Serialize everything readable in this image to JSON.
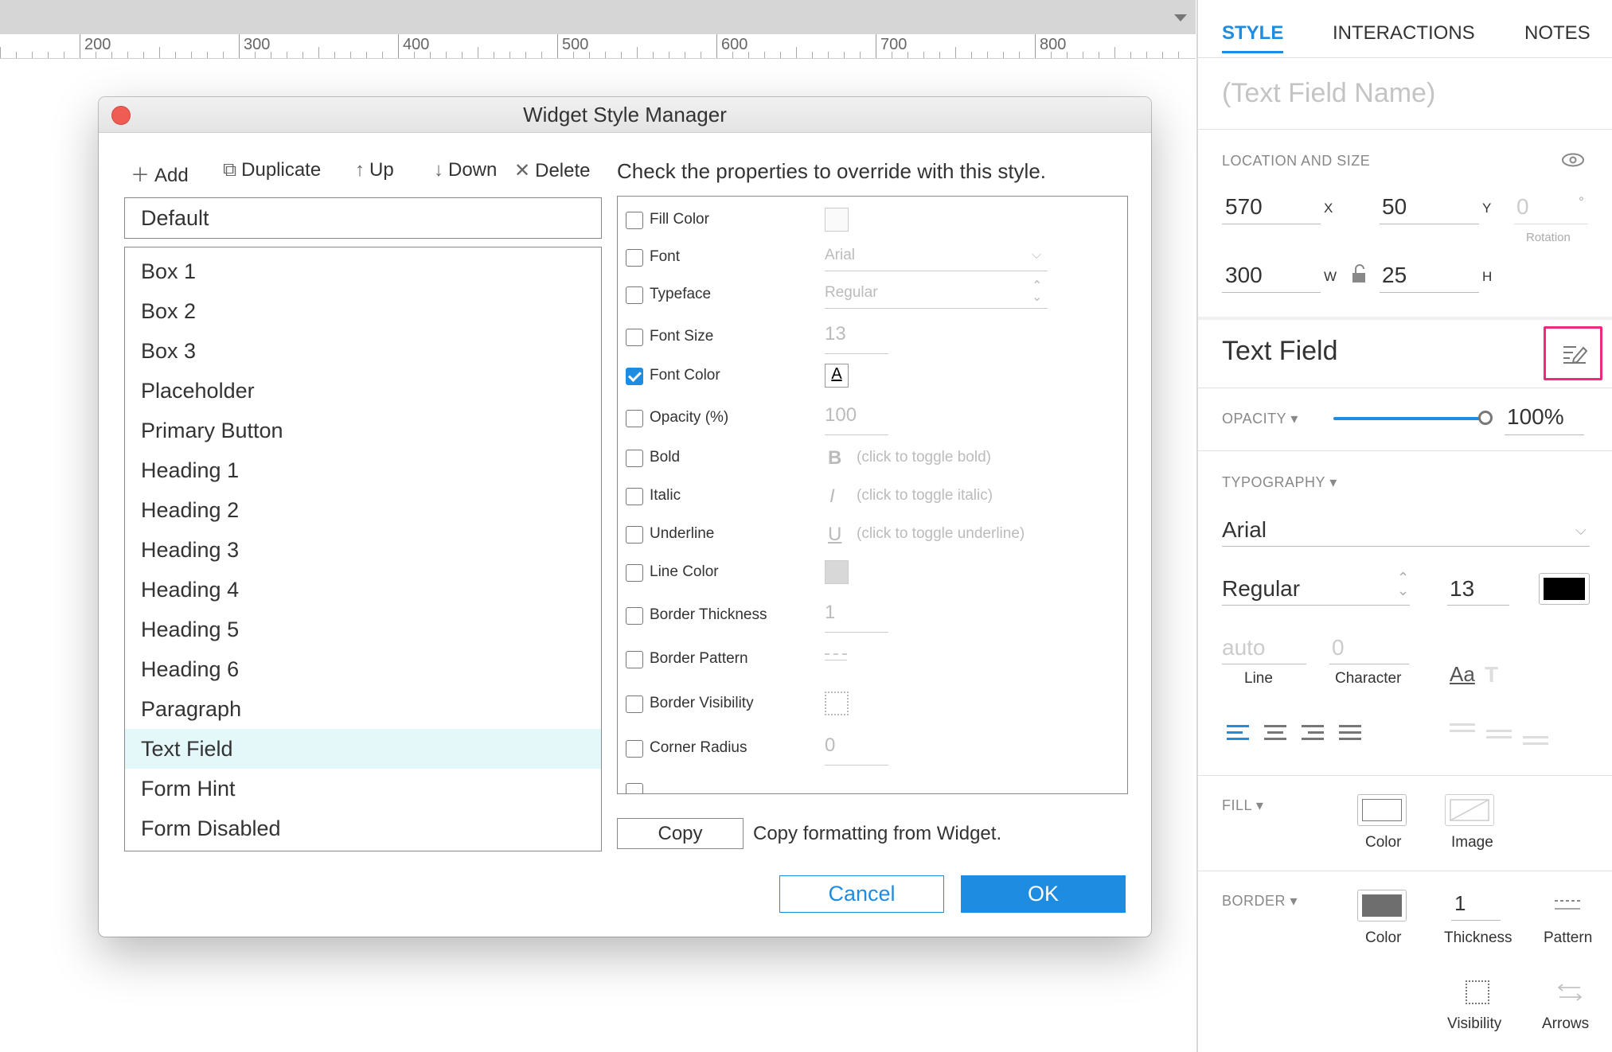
{
  "ruler": {
    "labels": [
      "200",
      "300",
      "400",
      "500",
      "600",
      "700",
      "800"
    ]
  },
  "dialog": {
    "title": "Widget Style Manager",
    "toolbar": {
      "add": "Add",
      "duplicate": "Duplicate",
      "up": "Up",
      "down": "Down",
      "delete": "Delete"
    },
    "default_style": "Default",
    "styles": [
      "Box 1",
      "Box 2",
      "Box 3",
      "Placeholder",
      "Primary Button",
      "Heading 1",
      "Heading 2",
      "Heading 3",
      "Heading 4",
      "Heading 5",
      "Heading 6",
      "Paragraph",
      "Text Field",
      "Form Hint",
      "Form Disabled"
    ],
    "selected_style": "Text Field",
    "override_heading": "Check the properties to override with this style.",
    "properties": {
      "fill_color": {
        "label": "Fill Color",
        "checked": false
      },
      "font": {
        "label": "Font",
        "value": "Arial",
        "checked": false
      },
      "typeface": {
        "label": "Typeface",
        "value": "Regular",
        "checked": false
      },
      "font_size": {
        "label": "Font Size",
        "value": "13",
        "checked": false
      },
      "font_color": {
        "label": "Font Color",
        "checked": true
      },
      "opacity": {
        "label": "Opacity (%)",
        "value": "100",
        "checked": false
      },
      "bold": {
        "label": "Bold",
        "hint": "(click to toggle bold)",
        "checked": false
      },
      "italic": {
        "label": "Italic",
        "hint": "(click to toggle italic)",
        "checked": false
      },
      "underline": {
        "label": "Underline",
        "hint": "(click to toggle underline)",
        "checked": false
      },
      "line_color": {
        "label": "Line Color",
        "checked": false
      },
      "border_thickness": {
        "label": "Border Thickness",
        "value": "1",
        "checked": false
      },
      "border_pattern": {
        "label": "Border Pattern",
        "checked": false
      },
      "border_visibility": {
        "label": "Border Visibility",
        "checked": false
      },
      "corner_radius": {
        "label": "Corner Radius",
        "value": "0",
        "checked": false
      }
    },
    "copy_button": "Copy",
    "copy_text": "Copy formatting from Widget.",
    "cancel": "Cancel",
    "ok": "OK"
  },
  "right_panel": {
    "tabs": {
      "style": "STYLE",
      "interactions": "INTERACTIONS",
      "notes": "NOTES"
    },
    "name_placeholder": "(Text Field Name)",
    "location": {
      "heading": "LOCATION AND SIZE",
      "x": "570",
      "x_label": "X",
      "y": "50",
      "y_label": "Y",
      "rotation": "0",
      "rotation_unit": "°",
      "rotation_label": "Rotation",
      "w": "300",
      "w_label": "W",
      "h": "25",
      "h_label": "H"
    },
    "style_name": "Text Field",
    "opacity": {
      "label": "OPACITY",
      "value": "100%",
      "level": 1.0
    },
    "typography": {
      "label": "TYPOGRAPHY",
      "font": "Arial",
      "typeface": "Regular",
      "size": "13",
      "color": "#000000",
      "line_value": "auto",
      "line_label": "Line",
      "char_value": "0",
      "char_label": "Character",
      "aa": "Aa",
      "t": "T"
    },
    "fill": {
      "label": "FILL",
      "color_label": "Color",
      "image_label": "Image"
    },
    "border": {
      "label": "BORDER",
      "color": "#6e6e6e",
      "color_label": "Color",
      "thickness": "1",
      "thickness_label": "Thickness",
      "pattern_label": "Pattern",
      "visibility_label": "Visibility",
      "arrows_label": "Arrows"
    }
  },
  "colors": {
    "accent": "#1e8ce0",
    "highlight": "#ef2a7e",
    "selection": "#e4f8fa"
  }
}
